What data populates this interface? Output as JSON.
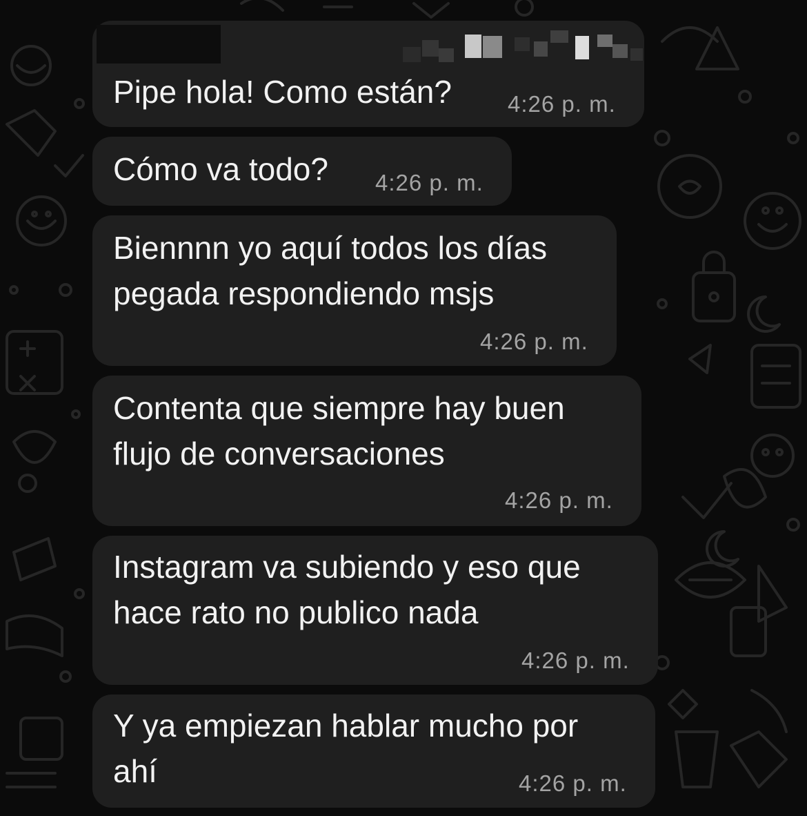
{
  "messages": [
    {
      "text": "Pipe hola! Como están?",
      "time": "4:26 p. m."
    },
    {
      "text": "Cómo va todo?",
      "time": "4:26 p. m."
    },
    {
      "text": "Biennnn yo aquí todos los días\npegada respondiendo msjs",
      "time": "4:26 p. m."
    },
    {
      "text": "Contenta que siempre hay buen\nflujo de conversaciones",
      "time": "4:26 p. m."
    },
    {
      "text": "Instagram va subiendo y eso que\nhace rato no publico nada",
      "time": "4:26 p. m."
    },
    {
      "text": "Y ya empiezan hablar mucho por\nahí",
      "time": "4:26 p. m."
    }
  ],
  "colors": {
    "background": "#0b0b0b",
    "bubble": "#1f1f1f",
    "text": "#f2f2f2",
    "timestamp": "#a4a4a4",
    "wallpaper_doodles": "#2a2a2a"
  },
  "icons": [
    "doodle-wallpaper",
    "pixelated-redaction"
  ]
}
